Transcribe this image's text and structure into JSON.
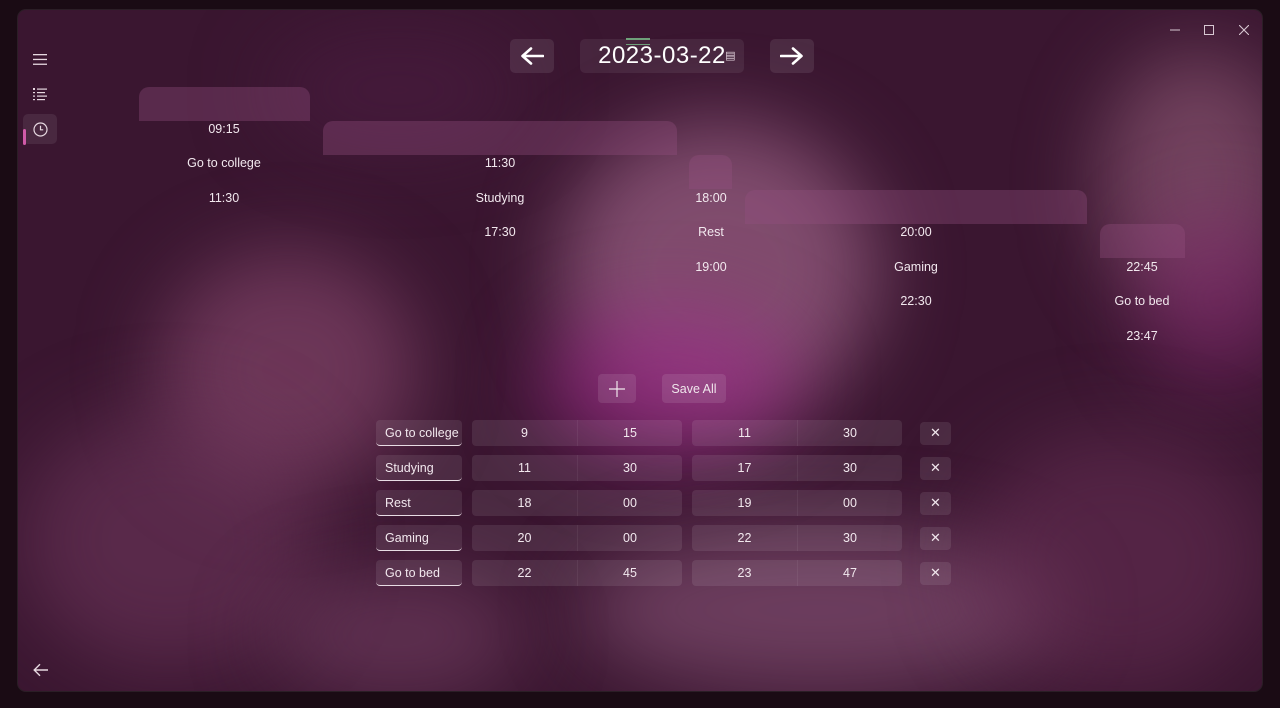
{
  "window": {
    "titlebar": {
      "minimize_icon": "minimize-icon",
      "maximize_icon": "maximize-icon",
      "close_icon": "close-icon"
    },
    "sidebar": {
      "items": [
        {
          "icon": "hamburger-menu-icon"
        },
        {
          "icon": "list-icon"
        },
        {
          "icon": "clock-icon",
          "active": true
        }
      ],
      "back_icon": "back-arrow-icon"
    }
  },
  "date_nav": {
    "prev_icon": "arrow-left-icon",
    "date": "2023-03-22",
    "calendar_icon": "calendar-icon",
    "next_icon": "arrow-right-icon"
  },
  "timeline": [
    {
      "start": "09:15",
      "name": "Go to college",
      "end": "11:30"
    },
    {
      "start": "11:30",
      "name": "Studying",
      "end": "17:30"
    },
    {
      "start": "18:00",
      "name": "Rest",
      "end": "19:00"
    },
    {
      "start": "20:00",
      "name": "Gaming",
      "end": "22:30"
    },
    {
      "start": "22:45",
      "name": "Go to bed",
      "end": "23:47"
    }
  ],
  "actions": {
    "add_icon": "plus-icon",
    "save_all_label": "Save All"
  },
  "entries": [
    {
      "name": "Go to college",
      "start_hour": "9",
      "start_minute": "15",
      "end_hour": "11",
      "end_minute": "30"
    },
    {
      "name": "Studying",
      "start_hour": "11",
      "start_minute": "30",
      "end_hour": "17",
      "end_minute": "30"
    },
    {
      "name": "Rest",
      "start_hour": "18",
      "start_minute": "00",
      "end_hour": "19",
      "end_minute": "00"
    },
    {
      "name": "Gaming",
      "start_hour": "20",
      "start_minute": "00",
      "end_hour": "22",
      "end_minute": "30"
    },
    {
      "name": "Go to bed",
      "start_hour": "22",
      "start_minute": "45",
      "end_hour": "23",
      "end_minute": "47"
    }
  ],
  "delete_icon": "close-x-icon",
  "colors": {
    "accent": "#d05aa8",
    "background": "#3a1630"
  }
}
